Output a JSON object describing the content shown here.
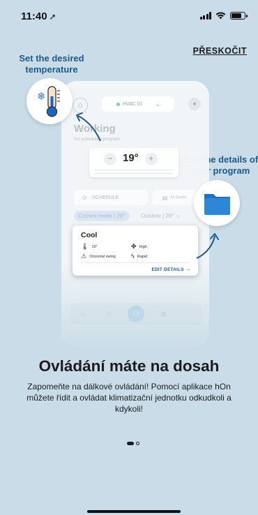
{
  "status_bar": {
    "time": "11:40"
  },
  "skip_label": "PŘESKOČIT",
  "callouts": {
    "temperature": "Set the desired temperature",
    "program": "Edit the details of your program"
  },
  "preview": {
    "device_name": "HVAC 01",
    "status_title": "Working",
    "status_sub": "No scheduled program",
    "temperature": "19°",
    "schedule_label": "SCHEDULE",
    "air_quality_label": "Air Quality",
    "current_mode": "Current mode | 28°",
    "outdoor": "Outdoor | 28°",
    "card": {
      "title": "Cool",
      "temp": "19°",
      "fan": "High",
      "swing": "Orizontal swing",
      "mode": "Rapid",
      "edit_label": "EDIT DETAILS"
    },
    "nav": [
      "Remotes",
      "Programs",
      "Devices",
      "More"
    ]
  },
  "heading": "Ovládání máte na dosah",
  "description": "Zapomeňte na dálkové ovládání! Pomocí aplikace hOn můžete řídit a ovládat klimatizační jednotku odkudkoli a kdykoli!",
  "pager": {
    "current": 1,
    "total": 2
  },
  "colors": {
    "background": "#c9dce7",
    "accent": "#1e5a88",
    "folder": "#2e86d6"
  }
}
